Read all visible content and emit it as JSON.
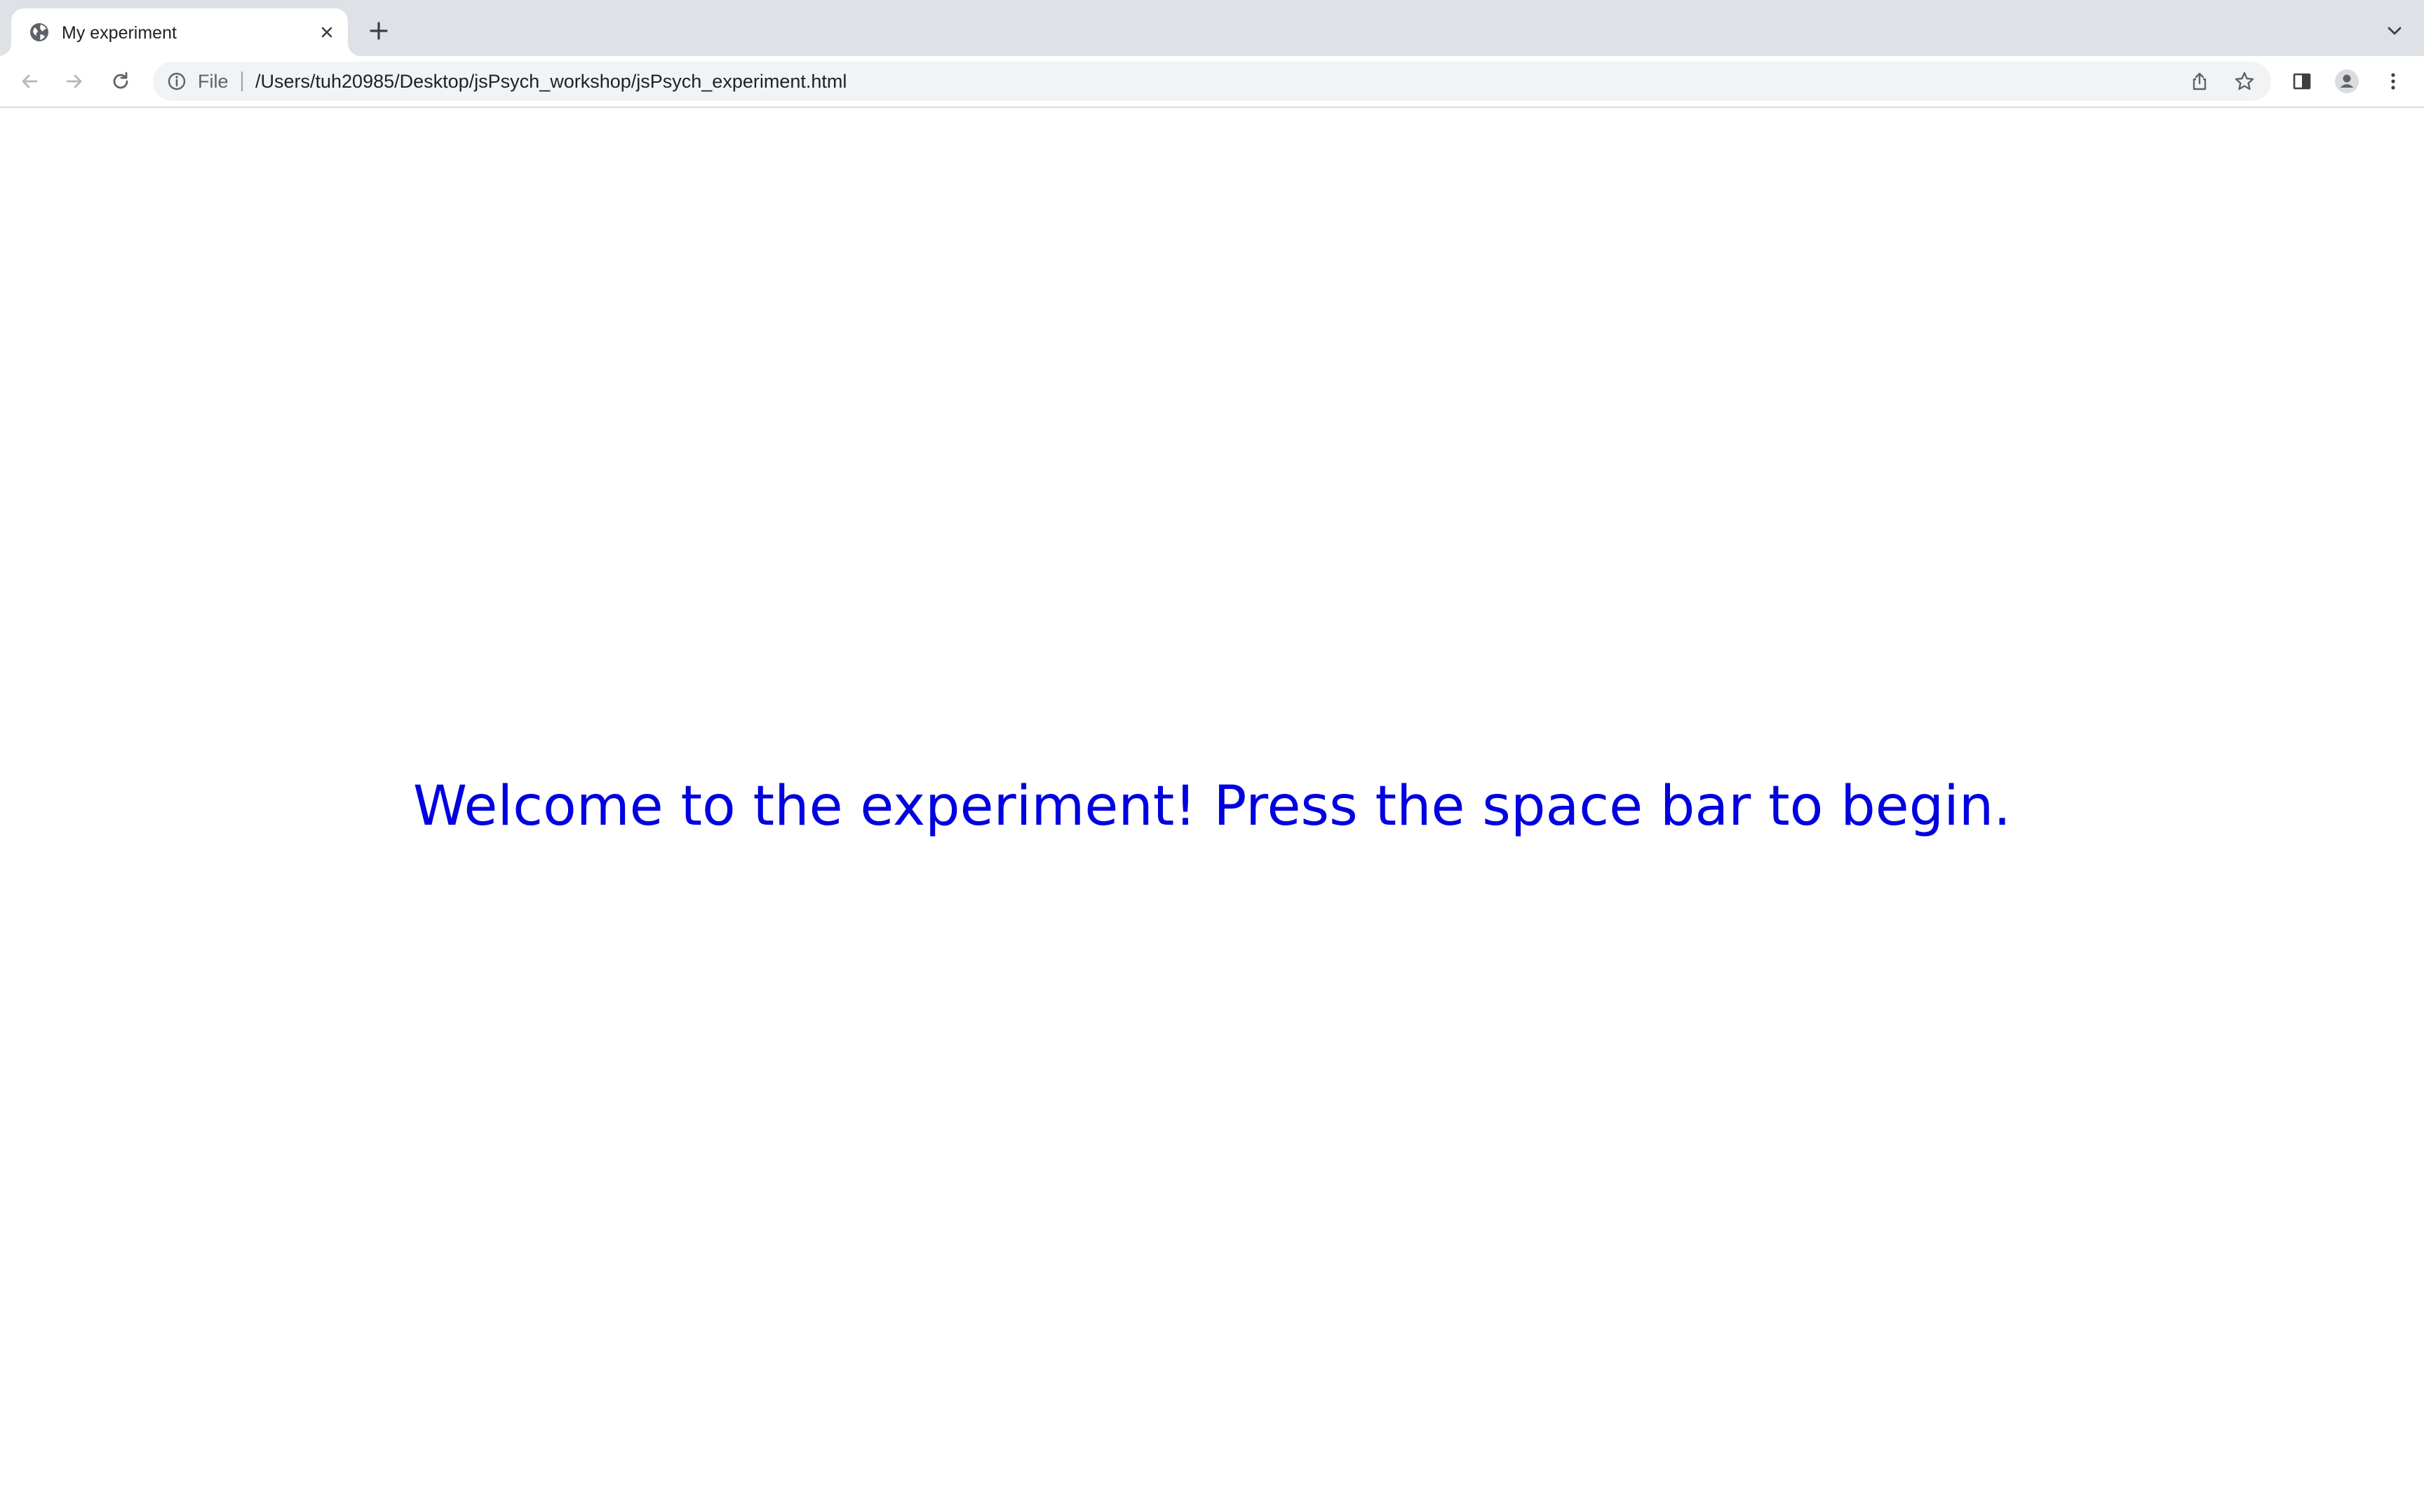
{
  "tab": {
    "title": "My experiment",
    "favicon": "globe-icon"
  },
  "toolbar": {
    "back_icon": "back-arrow-icon",
    "forward_icon": "forward-arrow-icon",
    "reload_icon": "reload-icon"
  },
  "omnibox": {
    "scheme_label": "File",
    "url": "/Users/tuh20985/Desktop/jsPsych_workshop/jsPsych_experiment.html"
  },
  "page": {
    "message": "Welcome to the experiment! Press the space bar to begin.",
    "message_color": "#0000e0"
  },
  "colors": {
    "tabstrip": "#dee1e6",
    "omnibox": "#f1f3f4",
    "icon": "#5f6368"
  }
}
